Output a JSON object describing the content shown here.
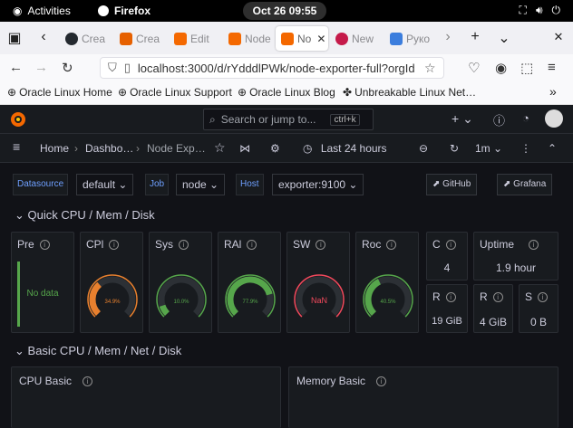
{
  "topbar": {
    "activities": "Activities",
    "app": "Firefox",
    "clock": "Oct 26  09:55"
  },
  "browser": {
    "tabs": [
      {
        "label": "Crea",
        "favicon_color": "#24292f"
      },
      {
        "label": "Crea",
        "favicon_color": "#e66000"
      },
      {
        "label": "Edit",
        "favicon_color": "#f46800"
      },
      {
        "label": "Node",
        "favicon_color": "#f46800"
      },
      {
        "label": "No",
        "favicon_color": "#f46800"
      },
      {
        "label": "New",
        "favicon_color": "#c51a4a"
      },
      {
        "label": "Руко",
        "favicon_color": "#3b7ddd"
      }
    ],
    "url": "localhost:3000/d/rYdddlPWk/node-exporter-full?orgId",
    "bookmarks": [
      "Oracle Linux Home",
      "Oracle Linux Support",
      "Oracle Linux Blog",
      "Unbreakable Linux Net…"
    ]
  },
  "grafana": {
    "search_placeholder": "Search or jump to...",
    "search_kbd": "ctrl+k",
    "breadcrumb": [
      "Home",
      "Dashbo…",
      "Node Exp…"
    ],
    "time_range": "Last 24 hours",
    "refresh": "1m",
    "vars": [
      {
        "label": "Datasource",
        "value": "default"
      },
      {
        "label": "Job",
        "value": "node"
      },
      {
        "label": "Host",
        "value": "exporter:9100"
      }
    ],
    "links": [
      "GitHub",
      "Grafana"
    ],
    "rows": [
      "Quick CPU / Mem / Disk",
      "Basic CPU / Mem / Net / Disk"
    ],
    "panels": {
      "pressure": {
        "title": "Pre",
        "value": "No data"
      },
      "cpu": {
        "title": "CPl",
        "value": "34.9%",
        "pct": 0.349,
        "color": "#e8802e"
      },
      "sys": {
        "title": "Sys",
        "value": "10.0%",
        "pct": 0.1,
        "color": "#56a64b"
      },
      "ram": {
        "title": "RAl",
        "value": "77.9%",
        "pct": 0.779,
        "color": "#56a64b"
      },
      "swap": {
        "title": "SW",
        "value": "NaN",
        "pct": 0,
        "color": "#f2495c"
      },
      "root": {
        "title": "Roc",
        "value": "40.5%",
        "pct": 0.405,
        "color": "#56a64b"
      },
      "cores": {
        "title": "C",
        "value": "4"
      },
      "uptime": {
        "title": "Uptime",
        "value": "1.9 hour"
      },
      "rootfs": {
        "title": "R",
        "value": "19 GiB"
      },
      "ramtotal": {
        "title": "R",
        "value": "4 GiB"
      },
      "swaptotal": {
        "title": "S",
        "value": "0 B"
      }
    },
    "bottom_panels": [
      "CPU Basic",
      "Memory Basic"
    ]
  }
}
